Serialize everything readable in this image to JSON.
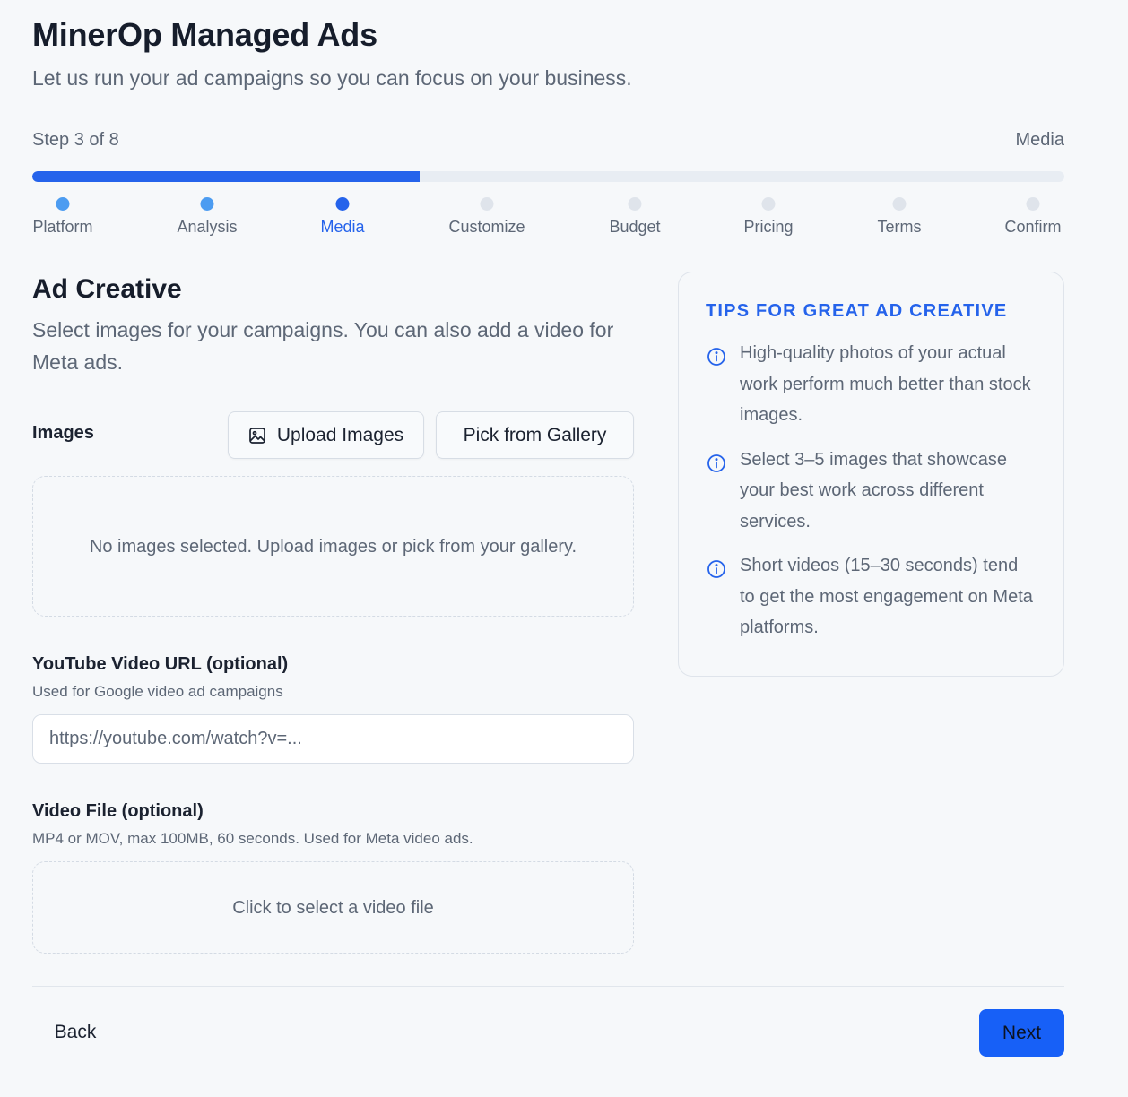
{
  "header": {
    "title": "MinerOp Managed Ads",
    "subtitle": "Let us run your ad campaigns so you can focus on your business."
  },
  "progress": {
    "step_text": "Step 3 of 8",
    "current_step_name": "Media",
    "fraction": 0.375,
    "steps": [
      {
        "label": "Platform",
        "state": "done"
      },
      {
        "label": "Analysis",
        "state": "done"
      },
      {
        "label": "Media",
        "state": "active"
      },
      {
        "label": "Customize",
        "state": "pending"
      },
      {
        "label": "Budget",
        "state": "pending"
      },
      {
        "label": "Pricing",
        "state": "pending"
      },
      {
        "label": "Terms",
        "state": "pending"
      },
      {
        "label": "Confirm",
        "state": "pending"
      }
    ]
  },
  "section": {
    "title": "Ad Creative",
    "description": "Select images for your campaigns. You can also add a video for Meta ads."
  },
  "images": {
    "label": "Images",
    "upload_label": "Upload Images",
    "gallery_label": "Pick from Gallery",
    "empty_text": "No images selected. Upload images or pick from your gallery."
  },
  "youtube": {
    "label": "YouTube Video URL (optional)",
    "help": "Used for Google video ad campaigns",
    "value": "",
    "placeholder": "https://youtube.com/watch?v=..."
  },
  "video_file": {
    "label": "Video File (optional)",
    "help": "MP4 or MOV, max 100MB, 60 seconds. Used for Meta video ads.",
    "dropzone_text": "Click to select a video file"
  },
  "tips": {
    "title": "TIPS FOR GREAT AD CREATIVE",
    "items": [
      "High-quality photos of your actual work perform much better than stock images.",
      "Select 3–5 images that showcase your best work across different services.",
      "Short videos (15–30 seconds) tend to get the most engagement on Meta platforms."
    ]
  },
  "footer": {
    "back_label": "Back",
    "next_label": "Next"
  },
  "colors": {
    "accent": "#2563eb",
    "step_done": "#4c9cf1",
    "step_pending": "#dfe4eb",
    "next_button": "#1760f7"
  },
  "icons": {
    "upload": "image-icon",
    "tip": "info-circle-icon"
  }
}
